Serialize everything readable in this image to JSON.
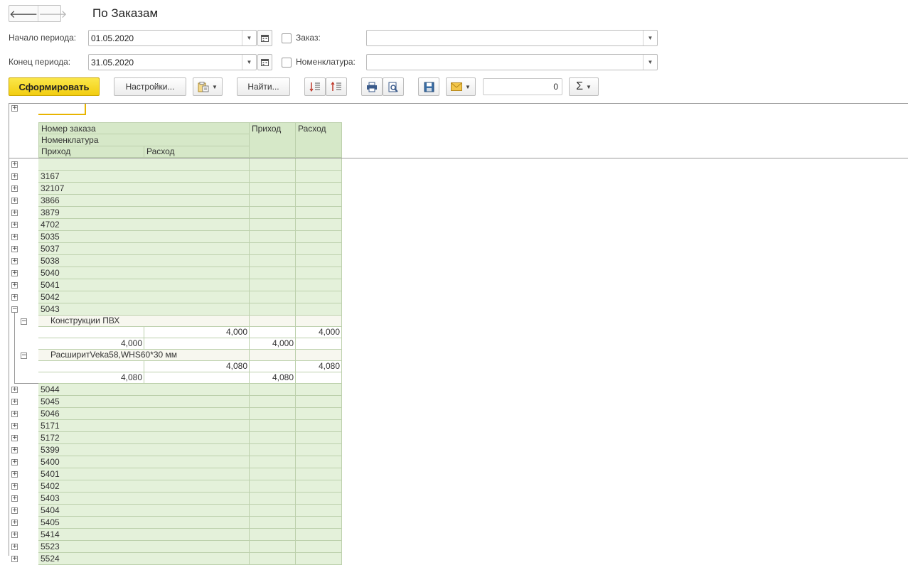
{
  "window": {
    "title": "По Заказам",
    "back_icon": "arrow-left-icon",
    "forward_icon": "arrow-right-icon"
  },
  "filters": {
    "start_label": "Начало периода:",
    "start_value": "01.05.2020",
    "end_label": "Конец периода:",
    "end_value": "31.05.2020",
    "order_label": "Заказ:",
    "order_value": "",
    "nomenclature_label": "Номенклатура:",
    "nomenclature_value": ""
  },
  "toolbar": {
    "generate_label": "Сформировать",
    "settings_label": "Настройки...",
    "find_label": "Найти...",
    "sum_value": "0",
    "icons": [
      "variants-icon",
      "expand-groups-icon",
      "collapse-groups-icon",
      "print-icon",
      "preview-icon",
      "save-icon",
      "email-icon",
      "sum-icon"
    ]
  },
  "report": {
    "headers": {
      "order_number": "Номер заказа",
      "nomenclature": "Номенклатура",
      "income": "Приход",
      "expense": "Расход",
      "sub_income": "Приход",
      "sub_expense": "Расход"
    },
    "orders_before": [
      "",
      "3167",
      "32107",
      "3866",
      "3879",
      "4702",
      "5035",
      "5037",
      "5038",
      "5040",
      "5041",
      "5042"
    ],
    "expanded_order": "5043",
    "expanded_items": [
      {
        "name": "Конструкции ПВХ",
        "qty_expense": "4,000",
        "total_expense": "4,000",
        "qty_income": "4,000",
        "total_income": "4,000"
      },
      {
        "name": "РасширитVeka58,WHS60*30 мм",
        "qty_expense": "4,080",
        "total_expense": "4,080",
        "qty_income": "4,080",
        "total_income": "4,080"
      }
    ],
    "orders_after": [
      "5044",
      "5045",
      "5046",
      "5171",
      "5172",
      "5399",
      "5400",
      "5401",
      "5402",
      "5403",
      "5404",
      "5405",
      "5414",
      "5523",
      "5524"
    ]
  }
}
